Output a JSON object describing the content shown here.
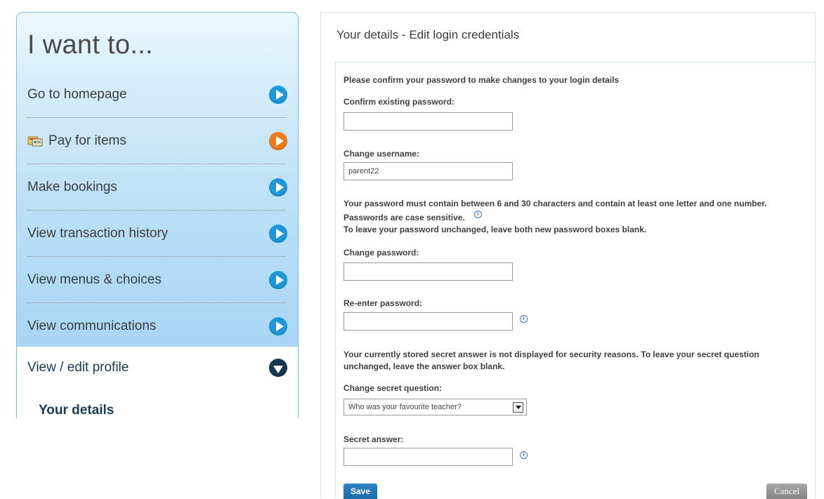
{
  "menu": {
    "title": "I want to...",
    "items": [
      {
        "label": "Go to homepage",
        "icon": "arrow-right-icon",
        "color": "#1c98d8"
      },
      {
        "label": "Pay for items",
        "icon": "arrow-right-icon",
        "color": "#f07b19"
      },
      {
        "label": "Make bookings",
        "icon": "arrow-right-icon",
        "color": "#1c98d8"
      },
      {
        "label": "View transaction history",
        "icon": "arrow-right-icon",
        "color": "#1c98d8"
      },
      {
        "label": "View menus & choices",
        "icon": "arrow-right-icon",
        "color": "#1c98d8"
      },
      {
        "label": "View communications",
        "icon": "arrow-right-icon",
        "color": "#1c98d8"
      }
    ],
    "profile": {
      "label": "View / edit profile",
      "icon": "arrow-down-icon",
      "color": "#16384f"
    },
    "sub_item": "Your details"
  },
  "page": {
    "heading": "Your details - Edit login credentials"
  },
  "form": {
    "intro": "Please confirm your password to make changes to your login details",
    "confirm_label": "Confirm existing password:",
    "confirm_value": "",
    "username_label": "Change username:",
    "username_value": "parent22",
    "pw_rule_1": "Your password must contain between 6 and 30 characters and contain at least one letter and one number.",
    "pw_rule_2": "Passwords are case sensitive.",
    "pw_rule_3": "To leave your password unchanged, leave both new password boxes blank.",
    "change_pw_label": "Change password:",
    "change_pw_value": "",
    "reenter_label": "Re-enter password:",
    "reenter_value": "",
    "secret_note_1": "Your currently stored secret answer is not displayed for security reasons. To leave your secret question",
    "secret_note_2": "unchanged, leave the answer box blank.",
    "question_label": "Change secret question:",
    "question_value": "Who was your favourite teacher?",
    "answer_label": "Secret answer:",
    "answer_value": "",
    "save_label": "Save",
    "cancel_label": "Cancel"
  },
  "colors": {
    "accent_blue": "#1c98d8",
    "accent_orange": "#f07b19",
    "dark_navy": "#16384f"
  }
}
